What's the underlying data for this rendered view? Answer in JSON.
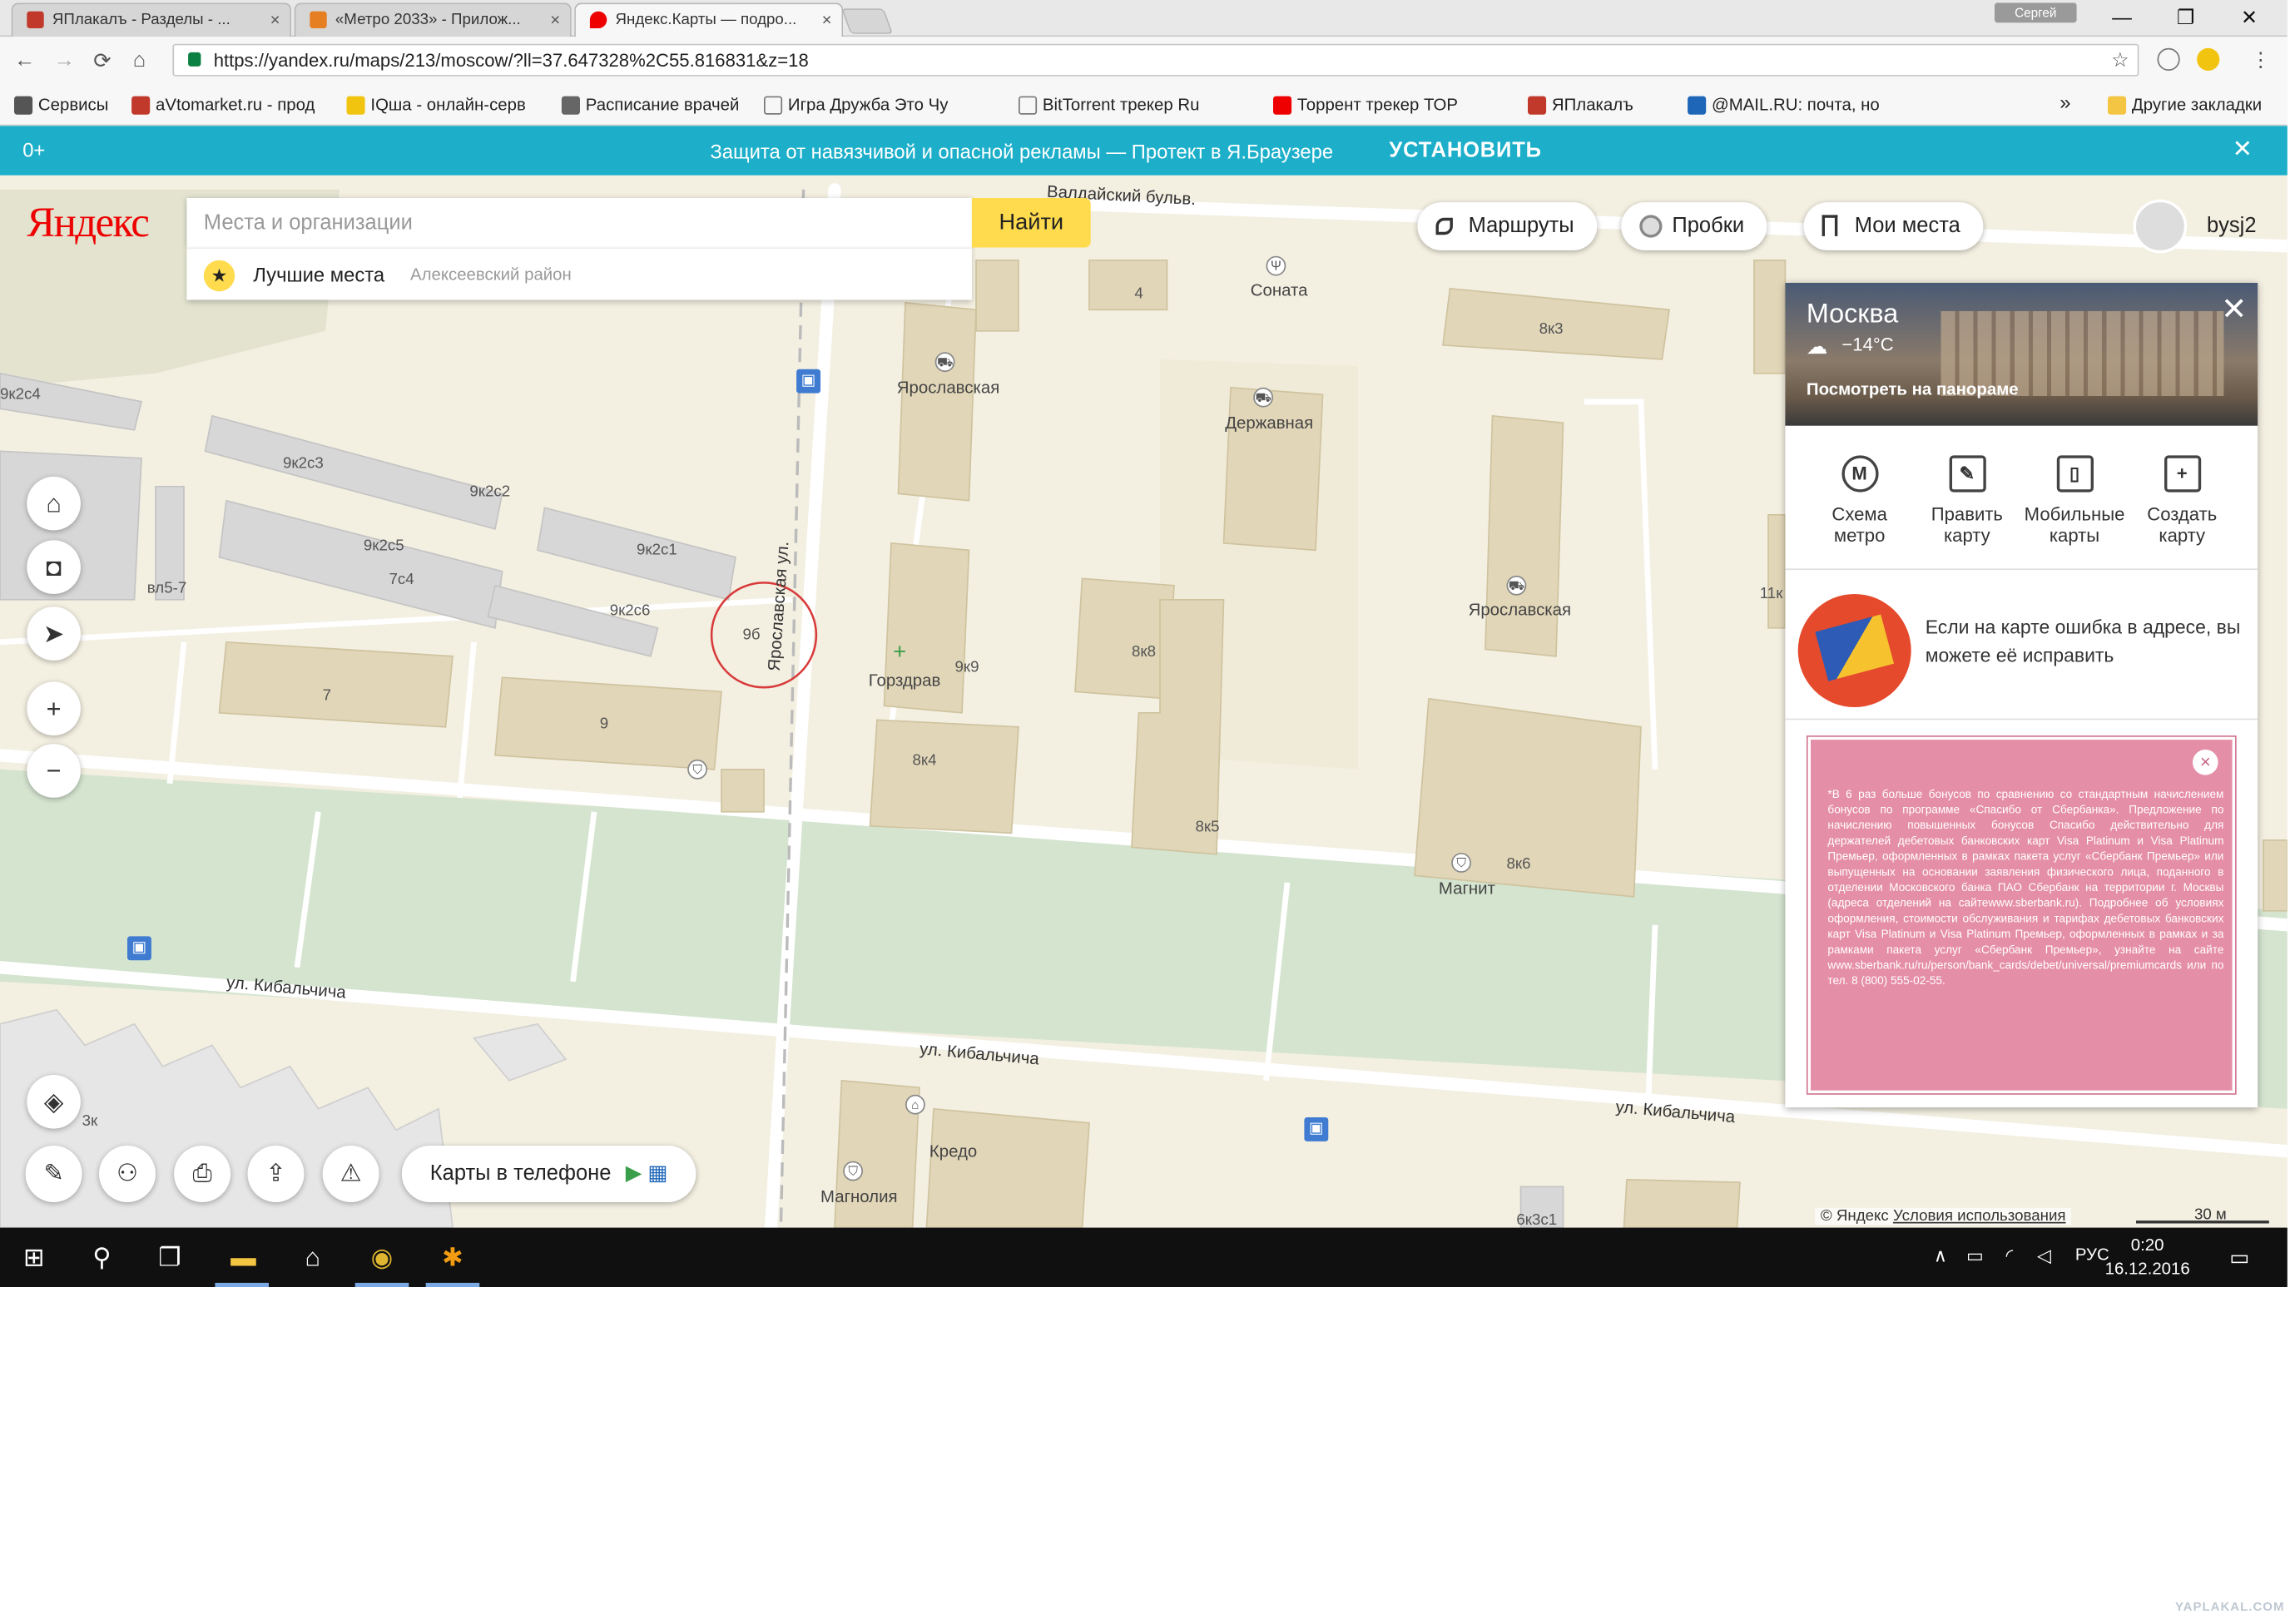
{
  "browser": {
    "tabs": [
      {
        "title": "ЯПлакалъ - Разделы - ...",
        "color": "#c0392b",
        "active": false
      },
      {
        "title": "«Метро 2033» - Прилож...",
        "color": "#e67e22",
        "active": false
      },
      {
        "title": "Яндекс.Карты — подро...",
        "color": "#e00",
        "active": true
      }
    ],
    "tab_close": "×",
    "user_badge": "Сергей",
    "window_controls": {
      "minimize": "—",
      "maximize": "❐",
      "close": "✕"
    },
    "nav": {
      "back": "←",
      "forward": "→",
      "reload": "⟳",
      "home": "⌂"
    },
    "url": "https://yandex.ru/maps/213/moscow/?ll=37.647328%2C55.816831&z=18",
    "star": "☆",
    "bookmarks": [
      {
        "label": "Сервисы",
        "color": "#555"
      },
      {
        "label": "aVtomarket.ru - прод",
        "color": "#c0392b"
      },
      {
        "label": "IQша - онлайн-серв",
        "color": "#f1c40f"
      },
      {
        "label": "Расписание врачей",
        "color": "#666"
      },
      {
        "label": "Игра Дружба Это Чу",
        "color": "#fff"
      },
      {
        "label": "BitTorrent трекер Ru",
        "color": "#fff"
      },
      {
        "label": "Торрент трекер ТОР",
        "color": "#e00"
      },
      {
        "label": "ЯПлакалъ",
        "color": "#c0392b"
      },
      {
        "label": "@MAIL.RU: почта, но",
        "color": "#1e66b8"
      }
    ],
    "more_bookmarks": "»",
    "other_bookmarks": "Другие закладки"
  },
  "promo": {
    "age": "0+",
    "text": "Защита от навязчивой и опасной рекламы — Протект в Я.Браузере",
    "install": "УСТАНОВИТЬ",
    "close": "✕"
  },
  "map": {
    "logo": "Яндекс",
    "search_placeholder": "Места и организации",
    "search_button": "Найти",
    "suggest_label": "Лучшие места",
    "suggest_sub": "Алексеевский район",
    "suggest_icon": "star-icon",
    "routes": "Маршруты",
    "traffic": "Пробки",
    "my_places": "Мои места",
    "user_name": "bysj2",
    "controls": {
      "home": "⌂",
      "briefcase": "◘",
      "locate": "➤",
      "zoom_in": "+",
      "zoom_out": "−",
      "layers": "◈"
    },
    "bottom_tools": {
      "ruler": "✎",
      "binoculars": "⚇",
      "print": "⎙",
      "share": "⇪",
      "report": "⚠"
    },
    "phone_label": "Карты в телефоне",
    "copyright": "© Яндекс",
    "terms": "Условия использования",
    "scale": "30 м",
    "labels": {
      "building_9b": "9б",
      "b9k2c5": "9к2с5",
      "b9k2c3": "9к2с3",
      "b9k2c2": "9к2с2",
      "b9k2c1": "9к2с1",
      "b9k2c6": "9к2с6",
      "b9k2c4": "9к2с4",
      "b7c4": "7с4",
      "b7": "7",
      "b9": "9",
      "b9k9": "9к9",
      "b8k4": "8к4",
      "b8k8": "8к8",
      "b8k5": "8к5",
      "b8k6": "8к6",
      "b8k3": "8к3",
      "b4": "4",
      "b5k7": "вл5-7",
      "b6k3c1": "6к3с1",
      "b11k": "11к",
      "b3k": "3к",
      "yar1": "Ярославская",
      "yar2": "Ярославская",
      "derzh": "Державная",
      "sonata": "Соната",
      "gorzdrav": "Горздрав",
      "magnit": "Магнит",
      "kredo": "Кредо",
      "magnolia": "Магнолия",
      "yar_street": "Ярославская ул.",
      "kib1": "ул. Кибальчича",
      "kib2": "ул. Кибальчича",
      "kib3": "ул. Кибальчича",
      "bulv": "Валдайский бульв."
    }
  },
  "panel": {
    "city": "Москва",
    "temp": "−14°C",
    "panorama": "Посмотреть на панораме",
    "close": "✕",
    "tools": [
      {
        "icon": "M",
        "label1": "Схема",
        "label2": "метро"
      },
      {
        "icon": "✎",
        "label1": "Править",
        "label2": "карту"
      },
      {
        "icon": "▯",
        "label1": "Мобильные",
        "label2": "карты"
      },
      {
        "icon": "+",
        "label1": "Создать",
        "label2": "карту"
      }
    ],
    "fix_text": "Если на карте ошибка в адресе, вы можете её исправить",
    "ad_text": "*В 6 раз больше бонусов по сравнению со стандартным начислением бонусов по программе «Спасибо от Сбербанка». Предложение по начислению повышенных бонусов Спасибо действительно для держателей дебетовых банковских карт Visa Platinum и Visa Platinum Премьер, оформленных в рамках пакета услуг «Сбербанк Премьер» или выпущенных на основании заявления физического лица, поданного в отделении Московского банка ПАО Сбербанк на территории г. Москвы (адреса отделений на сайтеwww.sberbank.ru). Подробнее об условиях оформления, стоимости обслуживания и тарифах дебетовых банковских карт Visa Platinum и Visa Platinum Премьер, оформленных в рамках и за рамками пакета услуг «Сбербанк Премьер», узнайте на сайте www.sberbank.ru/ru/person/bank_cards/debet/universal/premiumcards или по тел. 8 (800) 555-02-55.",
    "ad_close": "×"
  },
  "taskbar": {
    "start": "⊞",
    "search": "⚲",
    "task_view": "❐",
    "explorer": "▬",
    "home": "⌂",
    "chrome": "◉",
    "avast": "✱",
    "tray_up": "∧",
    "lang": "РУС",
    "time": "0:20",
    "date": "16.12.2016",
    "notif": "▭"
  },
  "watermark": "YAPLAKAL.COM"
}
